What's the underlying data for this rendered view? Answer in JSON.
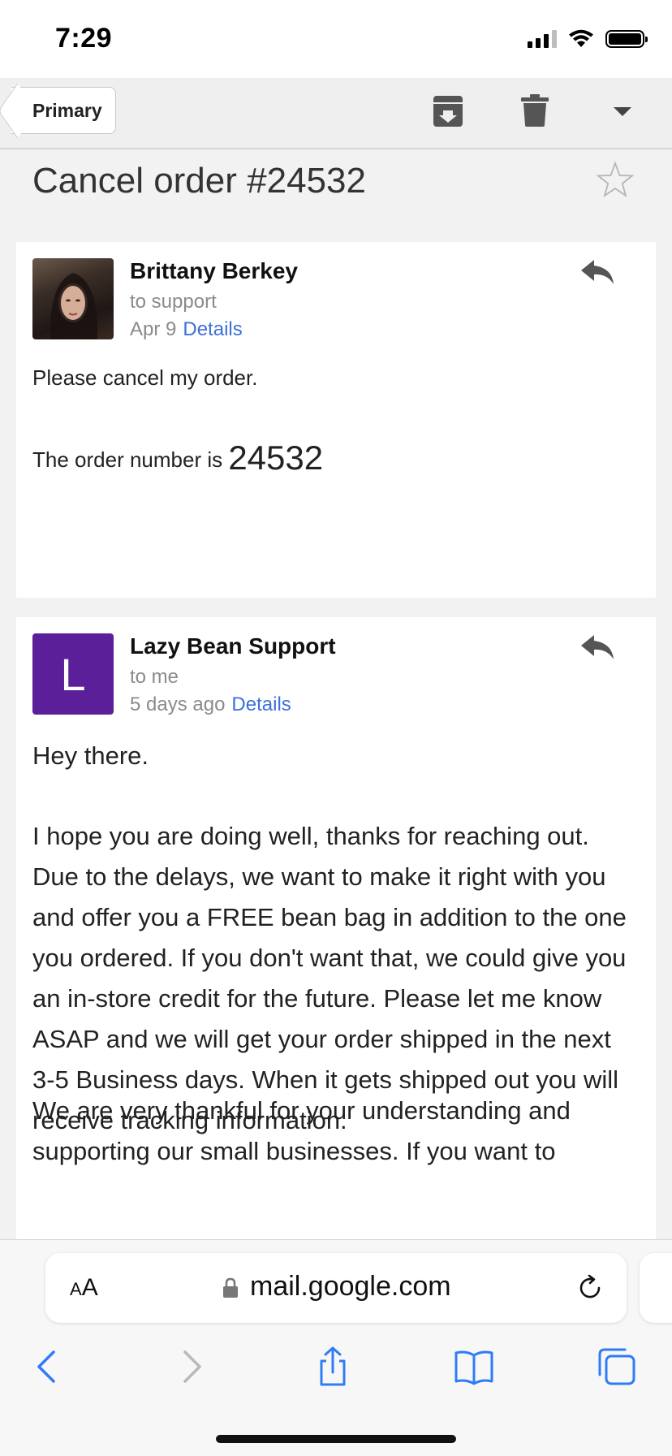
{
  "status_bar": {
    "time": "7:29"
  },
  "toolbar": {
    "back_label": "Primary"
  },
  "thread": {
    "subject": "Cancel order #24532"
  },
  "messages": [
    {
      "sender": "Brittany Berkey",
      "recipient": "to support",
      "date": "Apr 9",
      "details_label": "Details",
      "body_line1": "Please cancel my order.",
      "body_line2_prefix": "The order number is ",
      "body_line2_number": "24532"
    },
    {
      "sender": "Lazy Bean Support",
      "avatar_letter": "L",
      "recipient": "to me",
      "date": "5 days ago",
      "details_label": "Details",
      "greeting": "Hey there.",
      "paragraph1": "I hope you are doing well, thanks for reaching out. Due to the delays, we want to make it right with you and offer you a FREE bean bag in addition to the one you ordered. If you don't want that, we could give you an in-store credit for the future. Please let me know ASAP and we will get your order shipped in the next 3-5 Business days. When it gets shipped out you will receive tracking information.",
      "paragraph2": "We are very thankful for your understanding and supporting our small businesses. If you want to"
    }
  ],
  "browser": {
    "text_size_label_big": "A",
    "text_size_label_small": "A",
    "url": "mail.google.com"
  },
  "colors": {
    "avatar_purple": "#5a1f99",
    "link_blue": "#3b6fd8",
    "ios_blue": "#2f7cf6"
  }
}
